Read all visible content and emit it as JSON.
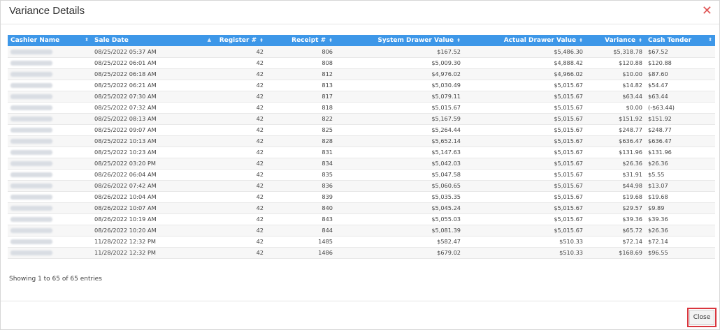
{
  "modal": {
    "title": "Variance Details",
    "close_icon": "close-icon",
    "accent_color": "#3d97e8",
    "close_color": "#e05555"
  },
  "table": {
    "headers": [
      "Cashier Name",
      "Sale Date",
      "Register #",
      "Receipt #",
      "System Drawer Value",
      "Actual Drawer Value",
      "Variance",
      "Cash Tender"
    ],
    "rows": [
      [
        "",
        "08/25/2022 05:37 AM",
        "42",
        "806",
        "$167.52",
        "$5,486.30",
        "$5,318.78",
        "$67.52"
      ],
      [
        "",
        "08/25/2022 06:01 AM",
        "42",
        "808",
        "$5,009.30",
        "$4,888.42",
        "$120.88",
        "$120.88"
      ],
      [
        "",
        "08/25/2022 06:18 AM",
        "42",
        "812",
        "$4,976.02",
        "$4,966.02",
        "$10.00",
        "$87.60"
      ],
      [
        "",
        "08/25/2022 06:21 AM",
        "42",
        "813",
        "$5,030.49",
        "$5,015.67",
        "$14.82",
        "$54.47"
      ],
      [
        "",
        "08/25/2022 07:30 AM",
        "42",
        "817",
        "$5,079.11",
        "$5,015.67",
        "$63.44",
        "$63.44"
      ],
      [
        "",
        "08/25/2022 07:32 AM",
        "42",
        "818",
        "$5,015.67",
        "$5,015.67",
        "$0.00",
        "(-$63.44)"
      ],
      [
        "",
        "08/25/2022 08:13 AM",
        "42",
        "822",
        "$5,167.59",
        "$5,015.67",
        "$151.92",
        "$151.92"
      ],
      [
        "",
        "08/25/2022 09:07 AM",
        "42",
        "825",
        "$5,264.44",
        "$5,015.67",
        "$248.77",
        "$248.77"
      ],
      [
        "",
        "08/25/2022 10:13 AM",
        "42",
        "828",
        "$5,652.14",
        "$5,015.67",
        "$636.47",
        "$636.47"
      ],
      [
        "",
        "08/25/2022 10:23 AM",
        "42",
        "831",
        "$5,147.63",
        "$5,015.67",
        "$131.96",
        "$131.96"
      ],
      [
        "",
        "08/25/2022 03:20 PM",
        "42",
        "834",
        "$5,042.03",
        "$5,015.67",
        "$26.36",
        "$26.36"
      ],
      [
        "",
        "08/26/2022 06:04 AM",
        "42",
        "835",
        "$5,047.58",
        "$5,015.67",
        "$31.91",
        "$5.55"
      ],
      [
        "",
        "08/26/2022 07:42 AM",
        "42",
        "836",
        "$5,060.65",
        "$5,015.67",
        "$44.98",
        "$13.07"
      ],
      [
        "",
        "08/26/2022 10:04 AM",
        "42",
        "839",
        "$5,035.35",
        "$5,015.67",
        "$19.68",
        "$19.68"
      ],
      [
        "",
        "08/26/2022 10:07 AM",
        "42",
        "840",
        "$5,045.24",
        "$5,015.67",
        "$29.57",
        "$9.89"
      ],
      [
        "",
        "08/26/2022 10:19 AM",
        "42",
        "843",
        "$5,055.03",
        "$5,015.67",
        "$39.36",
        "$39.36"
      ],
      [
        "",
        "08/26/2022 10:20 AM",
        "42",
        "844",
        "$5,081.39",
        "$5,015.67",
        "$65.72",
        "$26.36"
      ],
      [
        "",
        "11/28/2022 12:32 PM",
        "42",
        "1485",
        "$582.47",
        "$510.33",
        "$72.14",
        "$72.14"
      ],
      [
        "",
        "11/28/2022 12:32 PM",
        "42",
        "1486",
        "$679.02",
        "$510.33",
        "$168.69",
        "$96.55"
      ]
    ]
  },
  "footer": {
    "info": "Showing 1 to 65 of 65 entries",
    "close_label": "Close"
  }
}
